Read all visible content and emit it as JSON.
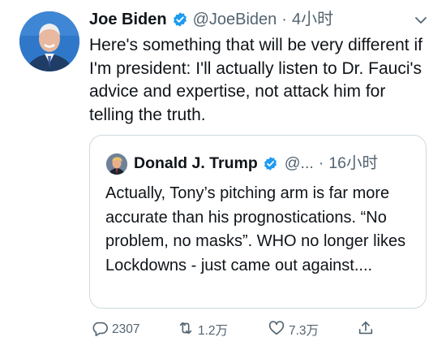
{
  "tweet": {
    "author_name": "Joe Biden",
    "handle": "@JoeBiden",
    "separator": "·",
    "time": "4小时",
    "text": "Here's something that will be very different if I'm president: I'll actually listen to Dr. Fauci's advice and expertise, not attack him for telling the truth."
  },
  "quoted_tweet": {
    "author_name": "Donald J. Trump",
    "handle": "@...",
    "separator": "·",
    "time": "16小时",
    "text": "Actually, Tony’s pitching arm is far more accurate than his prognostications. “No problem, no masks”. WHO no longer likes Lockdowns - just came out against...."
  },
  "actions": {
    "reply_count": "2307",
    "retweet_count": "1.2万",
    "like_count": "7.3万"
  },
  "colors": {
    "verified": "#1d9bf0",
    "text": "#0f1419",
    "muted": "#536471",
    "border": "#cfd9de"
  },
  "icons": [
    "verified-badge-icon",
    "chevron-down-icon",
    "reply-icon",
    "retweet-icon",
    "like-icon",
    "share-icon"
  ]
}
